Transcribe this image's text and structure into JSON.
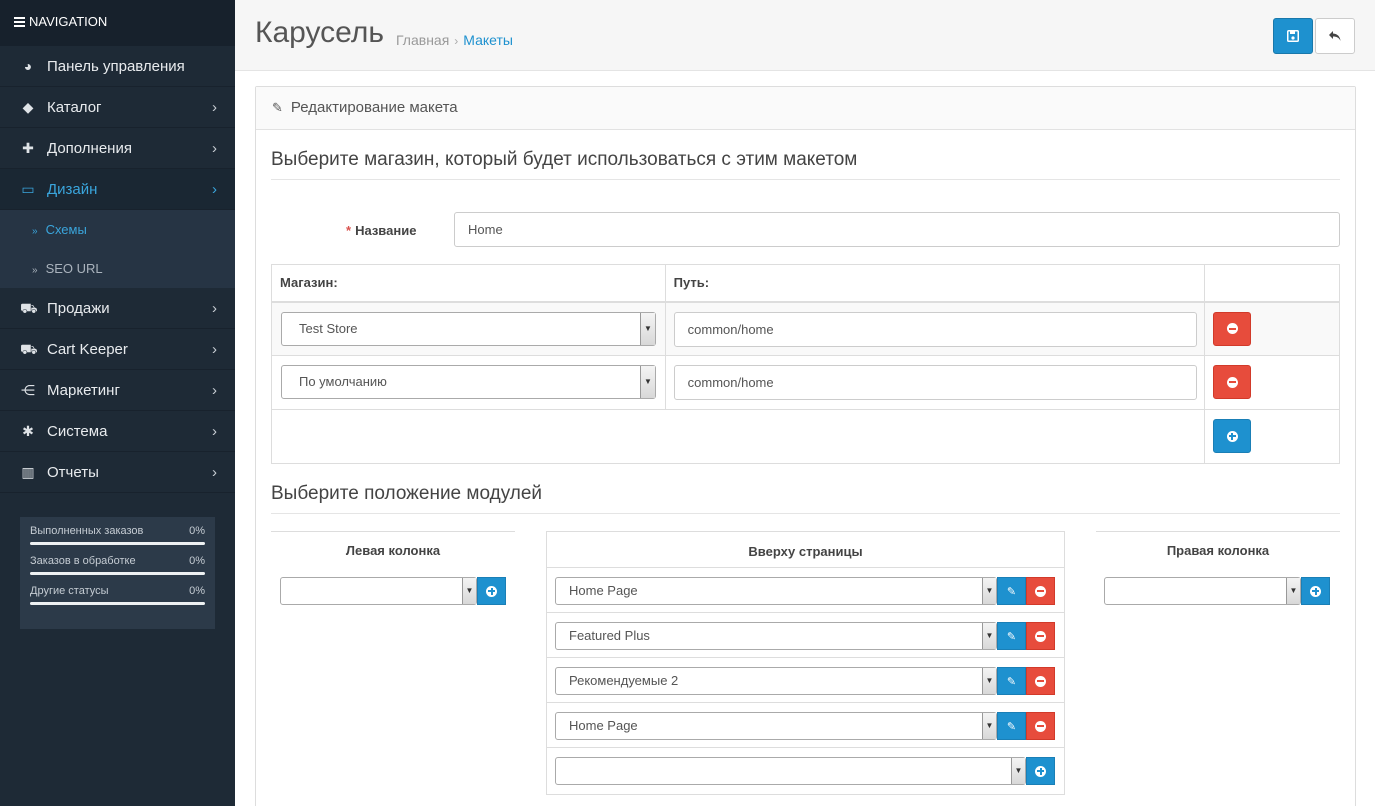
{
  "sidebar": {
    "header": "NAVIGATION",
    "items": [
      {
        "label": "Панель управления",
        "icon": "dashboard-icon",
        "glyph": "◕",
        "arrow": false
      },
      {
        "label": "Каталог",
        "icon": "tags-icon",
        "glyph": "◆",
        "arrow": true
      },
      {
        "label": "Дополнения",
        "icon": "puzzle-icon",
        "glyph": "✚",
        "arrow": true
      },
      {
        "label": "Дизайн",
        "icon": "monitor-icon",
        "glyph": "▭",
        "arrow": true,
        "active": true
      },
      {
        "label": "Продажи",
        "icon": "cart-icon",
        "glyph": "⛟",
        "arrow": true
      },
      {
        "label": "Cart Keeper",
        "icon": "cart-keeper-icon",
        "glyph": "⛟",
        "arrow": true
      },
      {
        "label": "Маркетинг",
        "icon": "share-icon",
        "glyph": "⋲",
        "arrow": true
      },
      {
        "label": "Система",
        "icon": "gear-icon",
        "glyph": "✱",
        "arrow": true
      },
      {
        "label": "Отчеты",
        "icon": "bar-chart-icon",
        "glyph": "▥",
        "arrow": true
      }
    ],
    "subitems": [
      {
        "label": "Схемы",
        "active": true
      },
      {
        "label": "SEO URL",
        "active": false
      }
    ],
    "stats": [
      {
        "label": "Выполненных заказов",
        "value": "0%"
      },
      {
        "label": "Заказов в обработке",
        "value": "0%"
      },
      {
        "label": "Другие статусы",
        "value": "0%"
      }
    ]
  },
  "header": {
    "title": "Карусель",
    "breadcrumb_home": "Главная",
    "breadcrumb_sep": "›",
    "breadcrumb_current": "Макеты"
  },
  "panel": {
    "heading": "Редактирование макета",
    "store_legend": "Выберите магазин, который будет использоваться с этим макетом",
    "name_label": "Название",
    "name_value": "Home",
    "table_headers": {
      "store": "Магазин:",
      "route": "Путь:"
    },
    "routes": [
      {
        "store": "Test Store",
        "route": "common/home"
      },
      {
        "store": "По умолчанию",
        "route": "common/home"
      }
    ],
    "module_legend": "Выберите положение модулей",
    "columns": {
      "left": "Левая колонка",
      "top": "Вверху страницы",
      "right": "Правая колонка"
    },
    "top_modules": [
      "Home Page",
      "Featured Plus",
      "Рекомендуемые 2",
      "Home Page"
    ]
  },
  "colors": {
    "primary": "#1e91cf",
    "danger": "#e74c3c",
    "sidebar_bg": "#1e2a36",
    "active_link": "#3aa5dc"
  }
}
